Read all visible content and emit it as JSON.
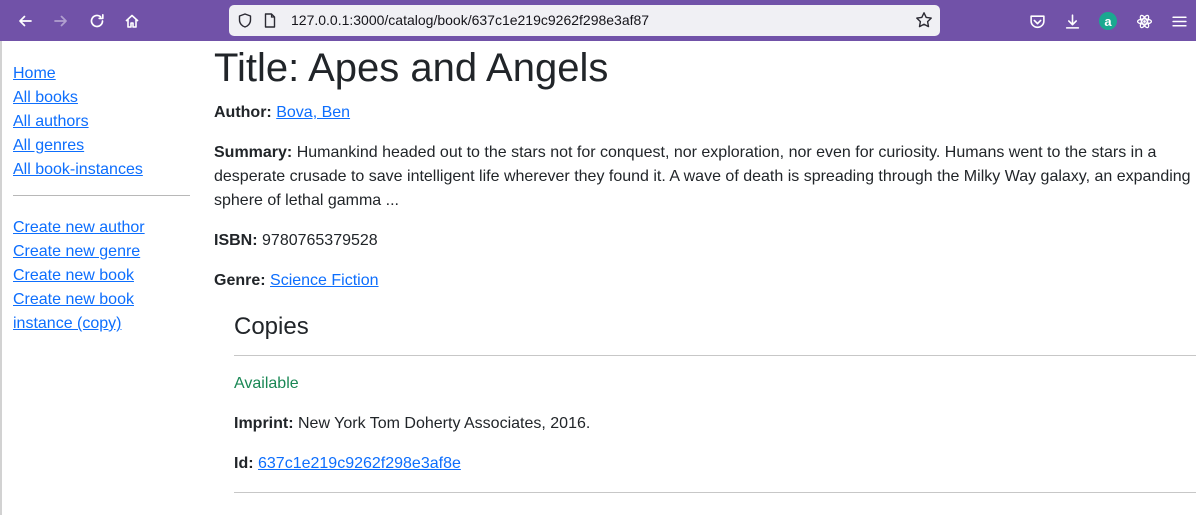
{
  "browser": {
    "url": "127.0.0.1:3000/catalog/book/637c1e219c9262f298e3af87",
    "colors": {
      "toolbar": "#7152a8",
      "urlbar": "#f0f0f4"
    },
    "icons": [
      "back-icon",
      "forward-icon",
      "reload-icon",
      "home-icon",
      "shield-icon",
      "page-icon",
      "star-icon",
      "pocket-icon",
      "download-icon",
      "account-icon",
      "extension-icon",
      "menu-icon"
    ],
    "account_letter": "a"
  },
  "sidebar": {
    "links": [
      "Home",
      "All books",
      "All authors",
      "All genres",
      "All book-instances"
    ],
    "create_links": [
      "Create new author",
      "Create new genre",
      "Create new book",
      "Create new book instance (copy)"
    ]
  },
  "book": {
    "title": "Title: Apes and Angels",
    "author_label": "Author:",
    "author": "Bova, Ben",
    "summary_label": "Summary:",
    "summary": "Humankind headed out to the stars not for conquest, nor exploration, nor even for curiosity. Humans went to the stars in a desperate crusade to save intelligent life wherever they found it. A wave of death is spreading through the Milky Way galaxy, an expanding sphere of lethal gamma ...",
    "isbn_label": "ISBN:",
    "isbn": "9780765379528",
    "genre_label": "Genre:",
    "genre": "Science Fiction"
  },
  "copies": {
    "heading": "Copies",
    "items": [
      {
        "status": "Available",
        "imprint_label": "Imprint:",
        "imprint": "New York Tom Doherty Associates, 2016.",
        "id_label": "Id:",
        "id": "637c1e219c9262f298e3af8e"
      }
    ],
    "colors": {
      "available": "#198754",
      "link": "#0d6efd"
    }
  }
}
